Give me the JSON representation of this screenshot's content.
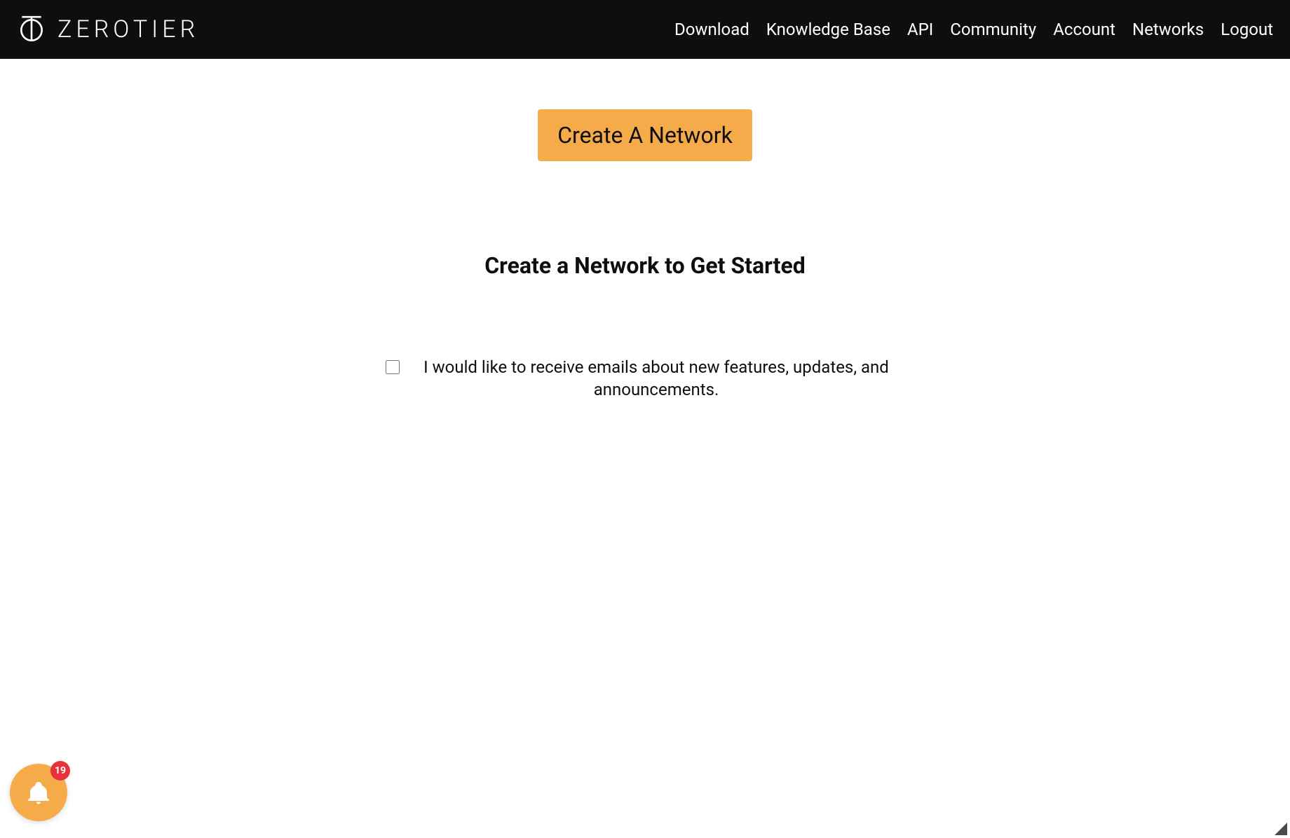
{
  "header": {
    "logo_text": "ZEROTIER",
    "nav": [
      {
        "label": "Download"
      },
      {
        "label": "Knowledge Base"
      },
      {
        "label": "API"
      },
      {
        "label": "Community"
      },
      {
        "label": "Account"
      },
      {
        "label": "Networks"
      },
      {
        "label": "Logout"
      }
    ]
  },
  "main": {
    "create_button_label": "Create A Network",
    "heading": "Create a Network to Get Started",
    "subscribe_label": "I would like to receive emails about new features, updates, and announcements."
  },
  "notification": {
    "count": "19"
  }
}
